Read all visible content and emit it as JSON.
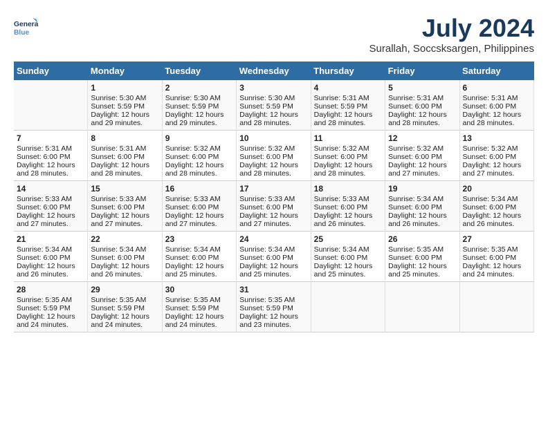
{
  "logo": {
    "line1": "General",
    "line2": "Blue"
  },
  "title": "July 2024",
  "subtitle": "Surallah, Soccsksargen, Philippines",
  "days_of_week": [
    "Sunday",
    "Monday",
    "Tuesday",
    "Wednesday",
    "Thursday",
    "Friday",
    "Saturday"
  ],
  "weeks": [
    [
      {
        "day": "",
        "content": ""
      },
      {
        "day": "1",
        "content": "Sunrise: 5:30 AM\nSunset: 5:59 PM\nDaylight: 12 hours\nand 29 minutes."
      },
      {
        "day": "2",
        "content": "Sunrise: 5:30 AM\nSunset: 5:59 PM\nDaylight: 12 hours\nand 29 minutes."
      },
      {
        "day": "3",
        "content": "Sunrise: 5:30 AM\nSunset: 5:59 PM\nDaylight: 12 hours\nand 28 minutes."
      },
      {
        "day": "4",
        "content": "Sunrise: 5:31 AM\nSunset: 5:59 PM\nDaylight: 12 hours\nand 28 minutes."
      },
      {
        "day": "5",
        "content": "Sunrise: 5:31 AM\nSunset: 6:00 PM\nDaylight: 12 hours\nand 28 minutes."
      },
      {
        "day": "6",
        "content": "Sunrise: 5:31 AM\nSunset: 6:00 PM\nDaylight: 12 hours\nand 28 minutes."
      }
    ],
    [
      {
        "day": "7",
        "content": "Sunrise: 5:31 AM\nSunset: 6:00 PM\nDaylight: 12 hours\nand 28 minutes."
      },
      {
        "day": "8",
        "content": "Sunrise: 5:31 AM\nSunset: 6:00 PM\nDaylight: 12 hours\nand 28 minutes."
      },
      {
        "day": "9",
        "content": "Sunrise: 5:32 AM\nSunset: 6:00 PM\nDaylight: 12 hours\nand 28 minutes."
      },
      {
        "day": "10",
        "content": "Sunrise: 5:32 AM\nSunset: 6:00 PM\nDaylight: 12 hours\nand 28 minutes."
      },
      {
        "day": "11",
        "content": "Sunrise: 5:32 AM\nSunset: 6:00 PM\nDaylight: 12 hours\nand 28 minutes."
      },
      {
        "day": "12",
        "content": "Sunrise: 5:32 AM\nSunset: 6:00 PM\nDaylight: 12 hours\nand 27 minutes."
      },
      {
        "day": "13",
        "content": "Sunrise: 5:32 AM\nSunset: 6:00 PM\nDaylight: 12 hours\nand 27 minutes."
      }
    ],
    [
      {
        "day": "14",
        "content": "Sunrise: 5:33 AM\nSunset: 6:00 PM\nDaylight: 12 hours\nand 27 minutes."
      },
      {
        "day": "15",
        "content": "Sunrise: 5:33 AM\nSunset: 6:00 PM\nDaylight: 12 hours\nand 27 minutes."
      },
      {
        "day": "16",
        "content": "Sunrise: 5:33 AM\nSunset: 6:00 PM\nDaylight: 12 hours\nand 27 minutes."
      },
      {
        "day": "17",
        "content": "Sunrise: 5:33 AM\nSunset: 6:00 PM\nDaylight: 12 hours\nand 27 minutes."
      },
      {
        "day": "18",
        "content": "Sunrise: 5:33 AM\nSunset: 6:00 PM\nDaylight: 12 hours\nand 26 minutes."
      },
      {
        "day": "19",
        "content": "Sunrise: 5:34 AM\nSunset: 6:00 PM\nDaylight: 12 hours\nand 26 minutes."
      },
      {
        "day": "20",
        "content": "Sunrise: 5:34 AM\nSunset: 6:00 PM\nDaylight: 12 hours\nand 26 minutes."
      }
    ],
    [
      {
        "day": "21",
        "content": "Sunrise: 5:34 AM\nSunset: 6:00 PM\nDaylight: 12 hours\nand 26 minutes."
      },
      {
        "day": "22",
        "content": "Sunrise: 5:34 AM\nSunset: 6:00 PM\nDaylight: 12 hours\nand 26 minutes."
      },
      {
        "day": "23",
        "content": "Sunrise: 5:34 AM\nSunset: 6:00 PM\nDaylight: 12 hours\nand 25 minutes."
      },
      {
        "day": "24",
        "content": "Sunrise: 5:34 AM\nSunset: 6:00 PM\nDaylight: 12 hours\nand 25 minutes."
      },
      {
        "day": "25",
        "content": "Sunrise: 5:34 AM\nSunset: 6:00 PM\nDaylight: 12 hours\nand 25 minutes."
      },
      {
        "day": "26",
        "content": "Sunrise: 5:35 AM\nSunset: 6:00 PM\nDaylight: 12 hours\nand 25 minutes."
      },
      {
        "day": "27",
        "content": "Sunrise: 5:35 AM\nSunset: 6:00 PM\nDaylight: 12 hours\nand 24 minutes."
      }
    ],
    [
      {
        "day": "28",
        "content": "Sunrise: 5:35 AM\nSunset: 5:59 PM\nDaylight: 12 hours\nand 24 minutes."
      },
      {
        "day": "29",
        "content": "Sunrise: 5:35 AM\nSunset: 5:59 PM\nDaylight: 12 hours\nand 24 minutes."
      },
      {
        "day": "30",
        "content": "Sunrise: 5:35 AM\nSunset: 5:59 PM\nDaylight: 12 hours\nand 24 minutes."
      },
      {
        "day": "31",
        "content": "Sunrise: 5:35 AM\nSunset: 5:59 PM\nDaylight: 12 hours\nand 23 minutes."
      },
      {
        "day": "",
        "content": ""
      },
      {
        "day": "",
        "content": ""
      },
      {
        "day": "",
        "content": ""
      }
    ]
  ]
}
